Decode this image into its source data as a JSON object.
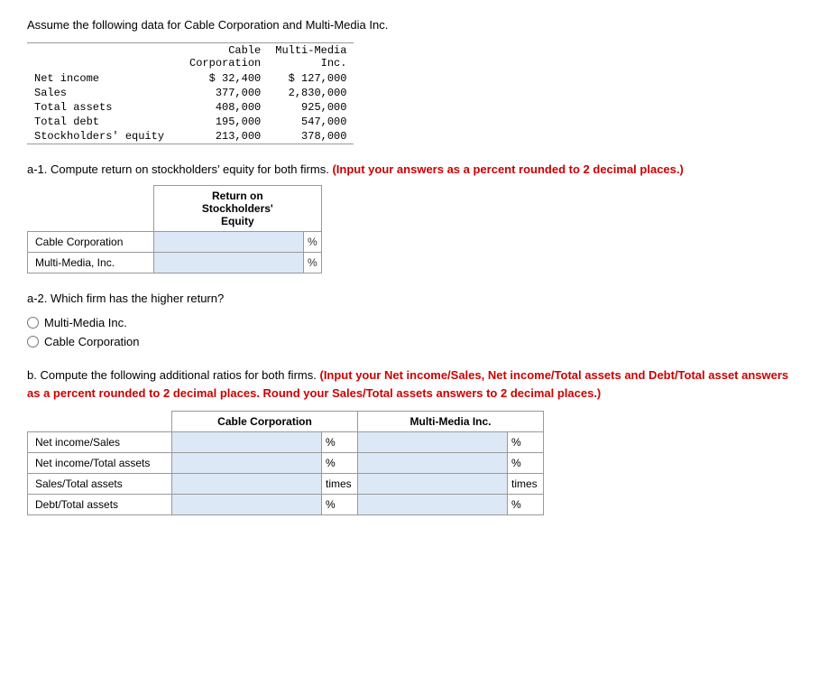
{
  "intro": {
    "text": "Assume the following data for Cable Corporation and Multi-Media Inc."
  },
  "data_table": {
    "col1_header_line1": "Cable",
    "col1_header_line2": "Corporation",
    "col2_header_line1": "Multi-Media",
    "col2_header_line2": "Inc.",
    "rows": [
      {
        "label": "Net income",
        "col1": "$ 32,400",
        "col2": "$  127,000"
      },
      {
        "label": "Sales",
        "col1": "377,000",
        "col2": "2,830,000"
      },
      {
        "label": "Total assets",
        "col1": "408,000",
        "col2": "925,000"
      },
      {
        "label": "Total debt",
        "col1": "195,000",
        "col2": "547,000"
      },
      {
        "label": "Stockholders' equity",
        "col1": "213,000",
        "col2": "378,000"
      }
    ]
  },
  "section_a1": {
    "label": "a-1.",
    "text": "Compute return on stockholders’ equity for both firms.",
    "bold_text": "(Input your answers as a percent rounded to 2 decimal places.)",
    "table_header": "Return on Stockholders’ Equity",
    "rows": [
      {
        "label": "Cable Corporation",
        "unit": "%"
      },
      {
        "label": "Multi-Media, Inc.",
        "unit": "%"
      }
    ]
  },
  "section_a2": {
    "question": "a-2. Which firm has the higher return?",
    "options": [
      {
        "label": "Multi-Media Inc."
      },
      {
        "label": "Cable Corporation"
      }
    ]
  },
  "section_b": {
    "label": "b.",
    "text": "Compute the following additional ratios for both firms.",
    "bold_text": "(Input your Net income/Sales, Net income/Total assets and Debt/Total asset answers as a percent rounded to 2 decimal places. Round your Sales/Total assets answers to 2 decimal places.)",
    "col1_header": "Cable Corporation",
    "col2_header": "Multi-Media Inc.",
    "rows": [
      {
        "label": "Net income/Sales",
        "unit1": "%",
        "unit2": "%"
      },
      {
        "label": "Net income/Total assets",
        "unit1": "%",
        "unit2": "%"
      },
      {
        "label": "Sales/Total assets",
        "unit1": "times",
        "unit2": "times"
      },
      {
        "label": "Debt/Total assets",
        "unit1": "%",
        "unit2": "%"
      }
    ]
  }
}
